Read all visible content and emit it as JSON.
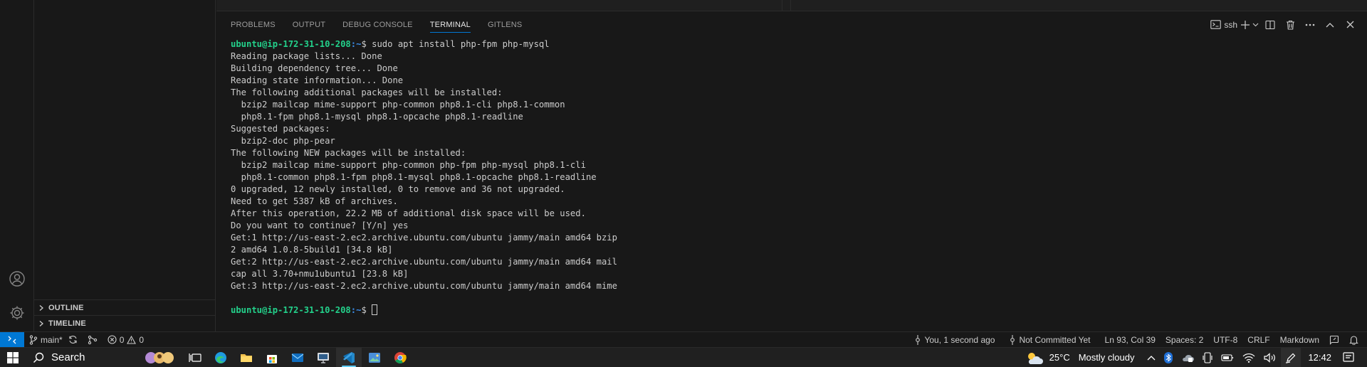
{
  "panel": {
    "tabs": [
      "PROBLEMS",
      "OUTPUT",
      "DEBUG CONSOLE",
      "TERMINAL",
      "GITLENS"
    ],
    "active_tab": "TERMINAL",
    "terminal_profile": "ssh"
  },
  "sidebar": {
    "sections": [
      "OUTLINE",
      "TIMELINE"
    ]
  },
  "terminal": {
    "prompt_user": "ubuntu@ip-172-31-10-208",
    "prompt_path": ":~",
    "prompt_symbol": "$",
    "command": " sudo apt install php-fpm php-mysql",
    "lines": [
      "Reading package lists... Done",
      "Building dependency tree... Done",
      "Reading state information... Done",
      "The following additional packages will be installed:",
      "  bzip2 mailcap mime-support php-common php8.1-cli php8.1-common",
      "  php8.1-fpm php8.1-mysql php8.1-opcache php8.1-readline",
      "Suggested packages:",
      "  bzip2-doc php-pear",
      "The following NEW packages will be installed:",
      "  bzip2 mailcap mime-support php-common php-fpm php-mysql php8.1-cli",
      "  php8.1-common php8.1-fpm php8.1-mysql php8.1-opcache php8.1-readline",
      "0 upgraded, 12 newly installed, 0 to remove and 36 not upgraded.",
      "Need to get 5387 kB of archives.",
      "After this operation, 22.2 MB of additional disk space will be used.",
      "Do you want to continue? [Y/n] yes",
      "Get:1 http://us-east-2.ec2.archive.ubuntu.com/ubuntu jammy/main amd64 bzip",
      "2 amd64 1.0.8-5build1 [34.8 kB]",
      "Get:2 http://us-east-2.ec2.archive.ubuntu.com/ubuntu jammy/main amd64 mail",
      "cap all 3.70+nmu1ubuntu1 [23.8 kB]",
      "Get:3 http://us-east-2.ec2.archive.ubuntu.com/ubuntu jammy/main amd64 mime",
      ""
    ]
  },
  "status_bar": {
    "branch": "main*",
    "errors": "0",
    "warnings": "0",
    "blame": "You, 1 second ago",
    "commit_state": "Not Committed Yet",
    "cursor_pos": "Ln 93, Col 39",
    "spaces": "Spaces: 2",
    "encoding": "UTF-8",
    "eol": "CRLF",
    "language": "Markdown"
  },
  "taskbar": {
    "search_label": "Search",
    "temperature": "25°C",
    "weather": "Mostly cloudy",
    "time": "12:42"
  },
  "colors": {
    "accent": "#0078d4",
    "prompt_user": "#23d18b",
    "prompt_path": "#3b8eea"
  }
}
